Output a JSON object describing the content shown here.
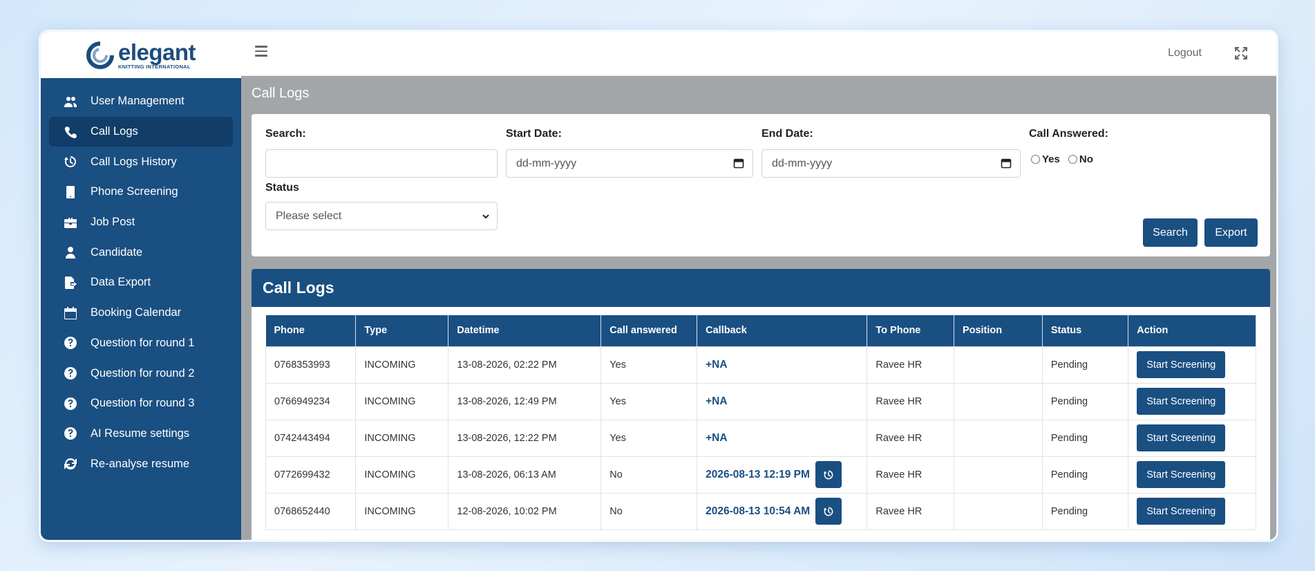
{
  "brand": {
    "name": "elegant",
    "tagline": "KNITTING INTERNATIONAL"
  },
  "sidebar": {
    "items": [
      {
        "label": "User Management",
        "icon": "users-icon"
      },
      {
        "label": "Call Logs",
        "icon": "phone-icon",
        "active": true
      },
      {
        "label": "Call Logs History",
        "icon": "history-icon"
      },
      {
        "label": "Phone Screening",
        "icon": "mobile-icon"
      },
      {
        "label": "Job Post",
        "icon": "briefcase-icon"
      },
      {
        "label": "Candidate",
        "icon": "user-icon"
      },
      {
        "label": "Data Export",
        "icon": "file-export-icon"
      },
      {
        "label": "Booking Calendar",
        "icon": "calendar-icon"
      },
      {
        "label": "Question for round 1",
        "icon": "question-circle-icon"
      },
      {
        "label": "Question for round 2",
        "icon": "question-circle-icon"
      },
      {
        "label": "Question for round 3",
        "icon": "question-circle-icon"
      },
      {
        "label": "AI Resume settings",
        "icon": "question-circle-icon"
      },
      {
        "label": "Re-analyse resume",
        "icon": "refresh-icon"
      }
    ]
  },
  "topbar": {
    "logout": "Logout"
  },
  "page": {
    "title": "Call Logs"
  },
  "filters": {
    "search_label": "Search:",
    "search_value": "",
    "start_label": "Start Date:",
    "start_placeholder": "dd-mm-yyyy",
    "end_label": "End Date:",
    "end_placeholder": "dd-mm-yyyy",
    "answered_label": "Call Answered:",
    "yes": "Yes",
    "no": "No",
    "status_label": "Status",
    "status_value": "Please select",
    "search_btn": "Search",
    "export_btn": "Export"
  },
  "logs": {
    "title": "Call Logs",
    "columns": [
      "Phone",
      "Type",
      "Datetime",
      "Call answered",
      "Callback",
      "To Phone",
      "Position",
      "Status",
      "Action"
    ],
    "rows": [
      {
        "phone": "0768353993",
        "type": "INCOMING",
        "datetime": "13-08-2026, 02:22 PM",
        "answered": "Yes",
        "callback": "+NA",
        "has_history": false,
        "to_phone": "Ravee HR",
        "position": "",
        "status": "Pending",
        "action": "Start Screening"
      },
      {
        "phone": "0766949234",
        "type": "INCOMING",
        "datetime": "13-08-2026, 12:49 PM",
        "answered": "Yes",
        "callback": "+NA",
        "has_history": false,
        "to_phone": "Ravee HR",
        "position": "",
        "status": "Pending",
        "action": "Start Screening"
      },
      {
        "phone": "0742443494",
        "type": "INCOMING",
        "datetime": "13-08-2026, 12:22 PM",
        "answered": "Yes",
        "callback": "+NA",
        "has_history": false,
        "to_phone": "Ravee HR",
        "position": "",
        "status": "Pending",
        "action": "Start Screening"
      },
      {
        "phone": "0772699432",
        "type": "INCOMING",
        "datetime": "13-08-2026, 06:13 AM",
        "answered": "No",
        "callback": "2026-08-13 12:19 PM",
        "has_history": true,
        "to_phone": "Ravee HR",
        "position": "",
        "status": "Pending",
        "action": "Start Screening"
      },
      {
        "phone": "0768652440",
        "type": "INCOMING",
        "datetime": "12-08-2026, 10:02 PM",
        "answered": "No",
        "callback": "2026-08-13 10:54 AM",
        "has_history": true,
        "to_phone": "Ravee HR",
        "position": "",
        "status": "Pending",
        "action": "Start Screening"
      }
    ]
  },
  "colors": {
    "primary": "#1a4f82",
    "sidebar_active": "#123d68",
    "main_bg": "#a3a6a9"
  }
}
